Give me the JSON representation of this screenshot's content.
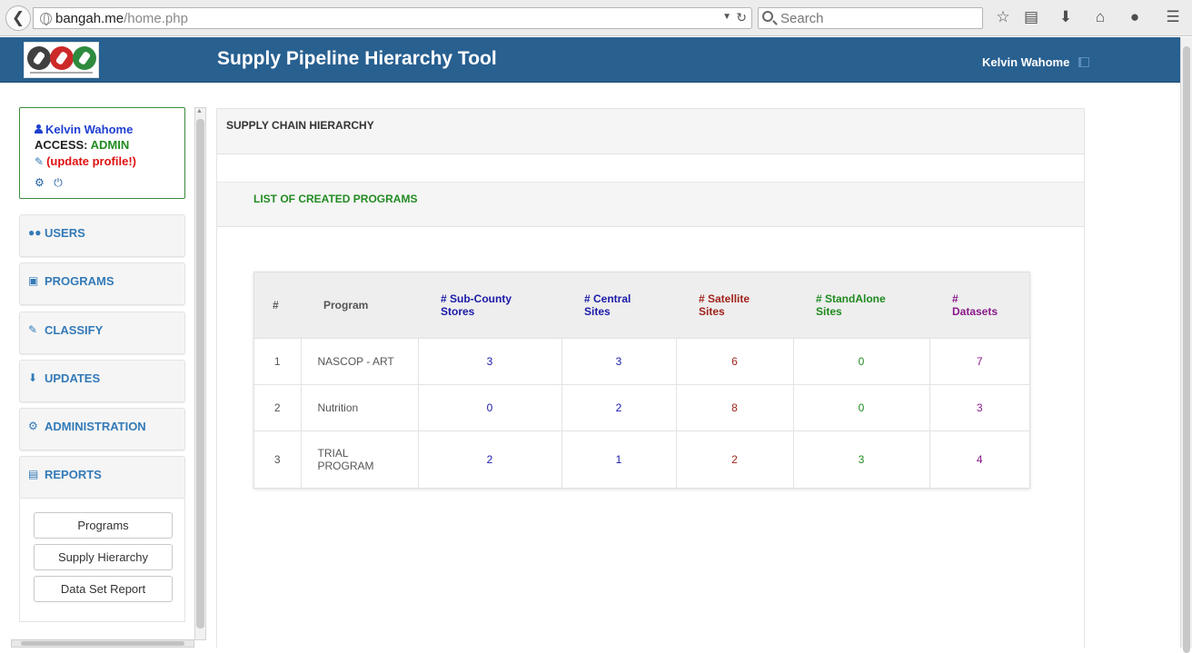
{
  "browser": {
    "url_host": "bangah.me",
    "url_path": "/home.php",
    "search_placeholder": "Search"
  },
  "header": {
    "title": "Supply Pipeline Hierarchy Tool",
    "user_name": "Kelvin Wahome"
  },
  "profile": {
    "name": "Kelvin Wahome",
    "access_label": "ACCESS:",
    "access_role": "ADMIN",
    "update_link": "(update profile!)"
  },
  "sidebar": {
    "menu": [
      {
        "label": "USERS",
        "icon": "users-icon"
      },
      {
        "label": "PROGRAMS",
        "icon": "briefcase-icon"
      },
      {
        "label": "CLASSIFY",
        "icon": "edit-icon"
      },
      {
        "label": "UPDATES",
        "icon": "download-icon"
      },
      {
        "label": "ADMINISTRATION",
        "icon": "cogs-icon"
      },
      {
        "label": "REPORTS",
        "icon": "report-icon"
      }
    ],
    "reports": [
      "Programs",
      "Supply Hierarchy",
      "Data Set Report"
    ]
  },
  "main": {
    "panel_title": "SUPPLY CHAIN HIERARCHY",
    "list_title": "LIST OF CREATED PROGRAMS",
    "table": {
      "headers": {
        "num": "#",
        "program": "Program",
        "subcounty_a": "# Sub-County",
        "subcounty_b": "Stores",
        "central_a": "# Central",
        "central_b": "Sites",
        "satellite_a": "# Satellite",
        "satellite_b": "Sites",
        "standalone_a": "# StandAlone",
        "standalone_b": "Sites",
        "datasets_a": "#",
        "datasets_b": "Datasets"
      },
      "rows": [
        {
          "num": "1",
          "program": "NASCOP - ART",
          "subcounty": "3",
          "central": "3",
          "satellite": "6",
          "standalone": "0",
          "datasets": "7"
        },
        {
          "num": "2",
          "program": "Nutrition",
          "subcounty": "0",
          "central": "2",
          "satellite": "8",
          "standalone": "0",
          "datasets": "3"
        },
        {
          "num": "3",
          "program_a": "TRIAL",
          "program_b": "PROGRAM",
          "subcounty": "2",
          "central": "1",
          "satellite": "2",
          "standalone": "3",
          "datasets": "4"
        }
      ]
    }
  },
  "colors": {
    "header_bg": "#286090",
    "link_blue": "#337ab7",
    "admin_green": "#228b22",
    "update_red": "#e01010"
  }
}
